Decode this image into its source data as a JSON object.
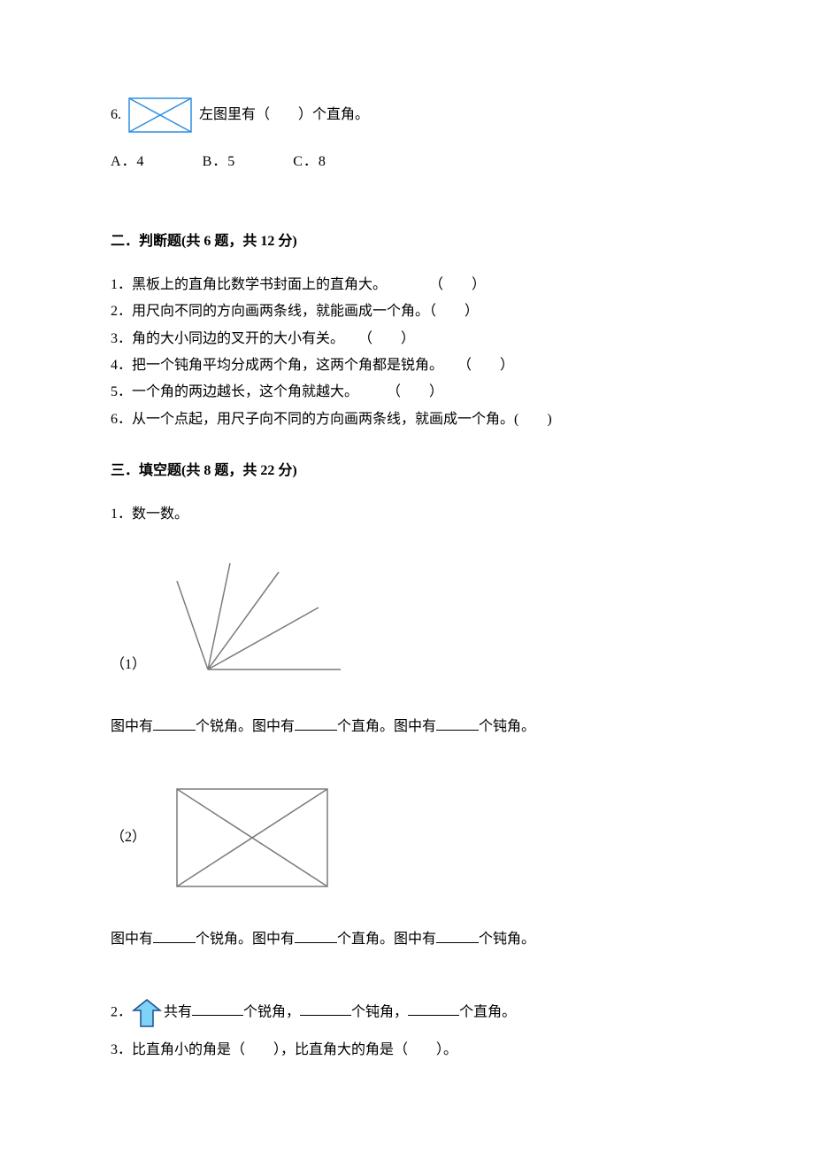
{
  "q6": {
    "prefix": "6.",
    "text_after": "左图里有（　　）个直角。",
    "options": {
      "a": "A．4",
      "b": "B．5",
      "c": "C．8"
    }
  },
  "section2": {
    "title": "二．判断题(共 6 题，共 12 分)",
    "items": [
      "1．黑板上的直角比数学书封面上的直角大。　　　　（　　）",
      "2．用尺向不同的方向画两条线，就能画成一个角。（　　）",
      "3．角的大小同边的叉开的大小有关。　　（　　）",
      "4．把一个钝角平均分成两个角，这两个角都是锐角。　　（　　）",
      "5．一个角的两边越长，这个角就越大。　　　（　　）",
      "6．从一个点起，用尺子向不同的方向画两条线，就画成一个角。(　　)"
    ]
  },
  "section3": {
    "title": "三．填空题(共 8 题，共 22 分)",
    "q1_label": "1．数一数。",
    "sub1_label": "（1）",
    "sub2_label": "（2）",
    "count_line_parts": {
      "p1": "图中有",
      "p2": "个锐角。图中有",
      "p3": "个直角。图中有",
      "p4": "个钝角。"
    },
    "q2": {
      "prefix": "2．",
      "p1": "共有",
      "p2": "个锐角，",
      "p3": "个钝角，",
      "p4": "个直角。"
    },
    "q3": "3．比直角小的角是（　　），比直角大的角是（　　）。"
  }
}
